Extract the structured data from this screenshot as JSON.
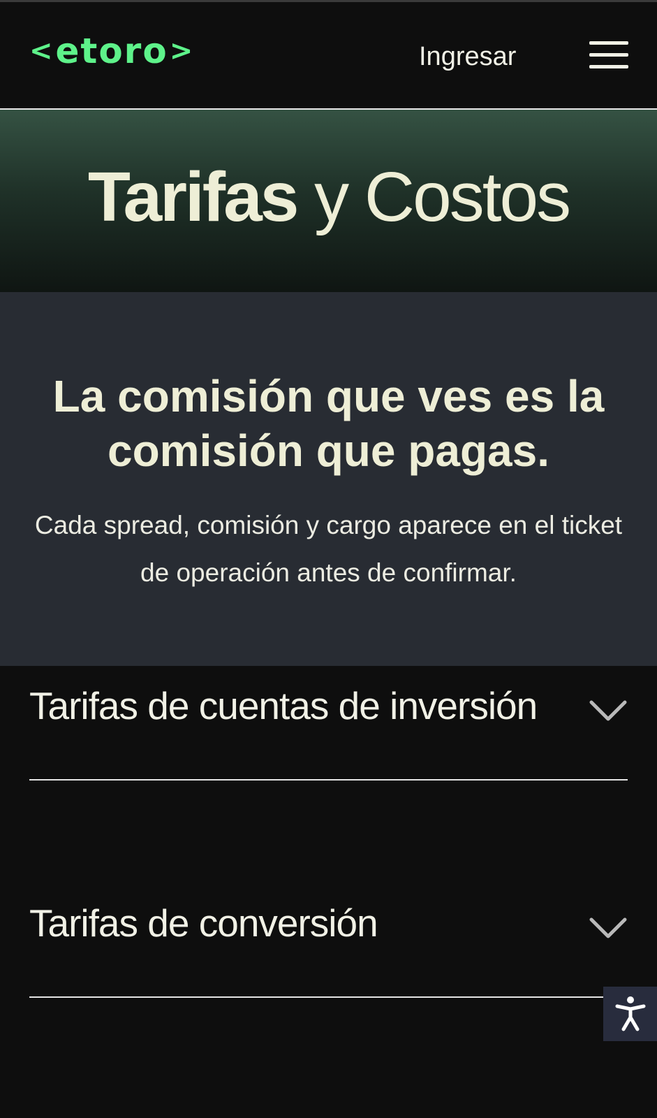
{
  "header": {
    "logo_text": "etoro",
    "logo_left_bracket": "<",
    "logo_right_bracket": ">",
    "login_label": "Ingresar",
    "menu_icon": "hamburger-menu-icon"
  },
  "hero": {
    "title_bold": "Tarifas",
    "title_light": "y Costos"
  },
  "promo": {
    "heading": "La comisión que ves es la comisión que pagas.",
    "body": "Cada spread, comisión y cargo aparece en el ticket de operación antes de confirmar."
  },
  "accordion": {
    "items": [
      {
        "label": "Tarifas de cuentas de inversión",
        "icon": "chevron-down-icon"
      },
      {
        "label": "Tarifas de conversión",
        "icon": "chevron-down-icon"
      }
    ]
  },
  "accessibility": {
    "icon": "accessibility-icon"
  },
  "colors": {
    "brand_green": "#5ef28a",
    "page_background": "#0e0e0e",
    "promo_background": "#282c33",
    "text_cream": "#eeeed6"
  }
}
